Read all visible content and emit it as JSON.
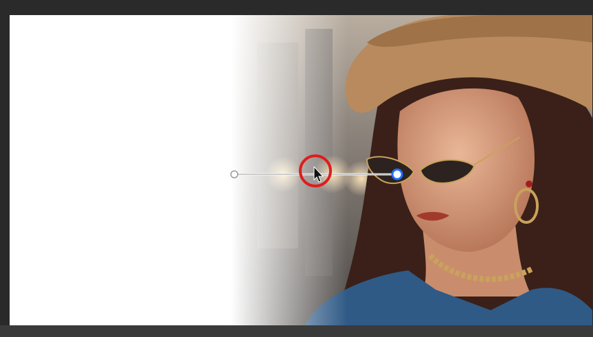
{
  "workspace": {
    "frame_color": "#2a2a2a",
    "canvas_background": "#ffffff"
  },
  "gradient_tool": {
    "start_color": "#ffffff",
    "end_color": "#1e6fff",
    "highlight_ring_color": "#e01c1c",
    "cursor_icon": "arrow-cursor-icon"
  },
  "photo": {
    "subject": "portrait",
    "hat_color": "#b88a5e",
    "jacket_color": "#2f5a86",
    "background_tones": [
      "#9c8f84",
      "#5e5b58",
      "#f3d7a8"
    ]
  }
}
